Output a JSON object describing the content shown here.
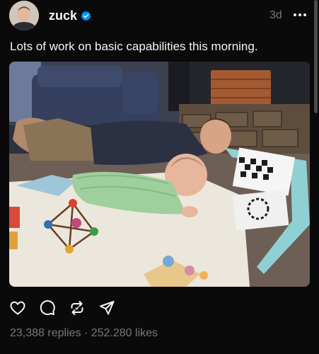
{
  "post": {
    "username": "zuck",
    "timestamp": "3d",
    "caption": "Lots of work on basic capabilities this morning.",
    "replies": "23,388 replies",
    "separator": " · ",
    "likes": "252.280 likes"
  },
  "icons": {
    "verified": "verified-badge-icon",
    "more": "more-options-icon",
    "like": "heart-icon",
    "reply": "comment-icon",
    "repost": "repost-icon",
    "share": "send-icon"
  },
  "colors": {
    "background": "#0a0a0a",
    "text": "#f3f5f7",
    "muted": "#777777",
    "verified": "#0095f6"
  }
}
